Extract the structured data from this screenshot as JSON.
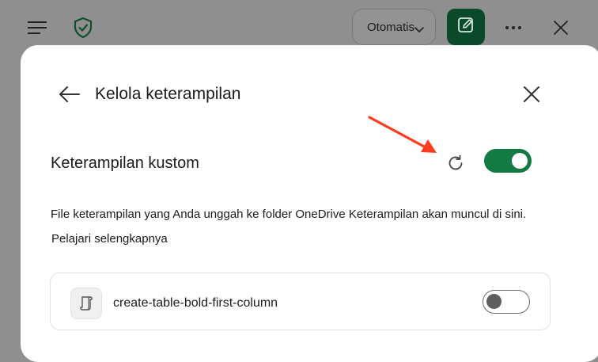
{
  "topbar": {
    "mode_select_value": "Otomatis",
    "icons": {
      "menu": "hamburger-icon",
      "shield": "shield-check-icon",
      "chevron": "chevron-down-icon",
      "compose": "compose-icon",
      "more": "more-horizontal-icon",
      "close": "close-icon"
    }
  },
  "panel": {
    "title": "Kelola keterampilan",
    "section_title": "Keterampilan kustom",
    "description": "File keterampilan yang Anda unggah ke folder OneDrive Keterampilan akan muncul di sini.",
    "learn_more": "Pelajari selengkapnya",
    "custom_skills_enabled": true,
    "skills": [
      {
        "name": "create-table-bold-first-column",
        "enabled": false,
        "icon": "script-scroll-icon"
      }
    ]
  },
  "colors": {
    "accent": "#137a43",
    "compose_bg": "#0a4a2b",
    "annotation": "#ff3b1f"
  }
}
